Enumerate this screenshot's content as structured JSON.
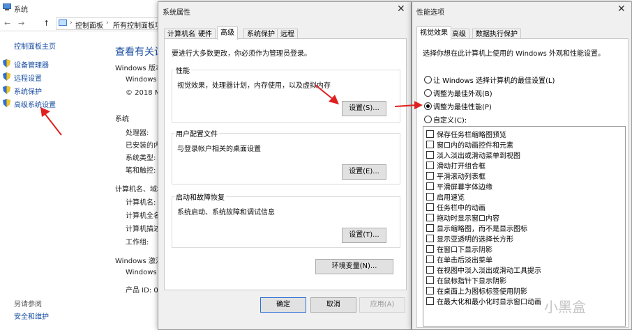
{
  "control_panel": {
    "title": "系统",
    "breadcrumbs": [
      "控制面板",
      "所有控制面板项"
    ],
    "nav_back": "←",
    "nav_forward": "→",
    "nav_up": "↑",
    "left_nav": {
      "home": "控制面板主页",
      "items": [
        "设备管理器",
        "远程设置",
        "系统保护",
        "高级系统设置"
      ]
    },
    "main_heading": "查看有关计",
    "windows_edition_label": "Windows 版本",
    "edition_lines": [
      "Windows 10",
      "© 2018 M"
    ],
    "system_label": "系统",
    "system_fields": [
      "处理器:",
      "已安装的内存",
      "系统类型:",
      "笔和触控:"
    ],
    "computer_label": "计算机名、域和",
    "computer_fields": [
      "计算机名:",
      "计算机全名",
      "计算机描述",
      "工作组:"
    ],
    "activation_label": "Windows 激活",
    "activation_lines": [
      "Windows i",
      "产品 ID: 00"
    ],
    "see_also": "另请参阅",
    "security": "安全和维护"
  },
  "system_properties": {
    "title": "系统属性",
    "close": "✕",
    "tabs": [
      "计算机名",
      "硬件",
      "高级",
      "系统保护",
      "远程"
    ],
    "active_tab": "高级",
    "admin_note": "要进行大多数更改，你必须作为管理员登录。",
    "performance": {
      "label": "性能",
      "desc": "视觉效果，处理器计划，内存使用，以及虚拟内存",
      "button": "设置(S)..."
    },
    "user_profiles": {
      "label": "用户配置文件",
      "desc": "与登录帐户相关的桌面设置",
      "button": "设置(E)..."
    },
    "startup_recovery": {
      "label": "启动和故障恢复",
      "desc": "系统启动、系统故障和调试信息",
      "button": "设置(T)..."
    },
    "env_button": "环境变量(N)...",
    "ok": "确定",
    "cancel": "取消",
    "apply": "应用(A)"
  },
  "performance_options": {
    "title": "性能选项",
    "close": "✕",
    "tabs": [
      "视觉效果",
      "高级",
      "数据执行保护"
    ],
    "active_tab": "视觉效果",
    "intro": "选择你想在此计算机上使用的 Windows 外观和性能设置。",
    "radios": [
      {
        "label": "让 Windows 选择计算机的最佳设置(L)",
        "checked": false
      },
      {
        "label": "调整为最佳外观(B)",
        "checked": false
      },
      {
        "label": "调整为最佳性能(P)",
        "checked": true
      },
      {
        "label": "自定义(C):",
        "checked": false
      }
    ],
    "checkboxes": [
      "保存任务栏缩略图预览",
      "窗口内的动画控件和元素",
      "淡入淡出或滑动菜单到视图",
      "滑动打开组合框",
      "平滑滚动列表框",
      "平滑屏幕字体边缘",
      "启用速览",
      "任务栏中的动画",
      "拖动时显示窗口内容",
      "显示缩略图，而不是显示图标",
      "显示亚透明的选择长方形",
      "在窗口下显示阴影",
      "在单击后淡出菜单",
      "在视图中淡入淡出或滑动工具提示",
      "在鼠标指针下显示阴影",
      "在桌面上为图标标签使用阴影",
      "在最大化和最小化时显示窗口动画"
    ]
  },
  "watermark": "小黑盒",
  "colors": {
    "annotation_arrow": "#e02020",
    "link_blue": "#1a4fa3",
    "dialog_bg": "#f0f0f0",
    "focus_border": "#2b6fd6"
  }
}
